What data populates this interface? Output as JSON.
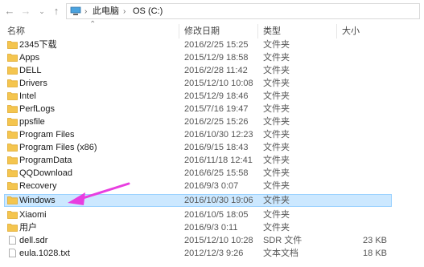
{
  "nav": {
    "back_icon": "arrow-left-icon",
    "forward_icon": "arrow-right-icon",
    "history_icon": "chevron-down-icon",
    "up_icon": "arrow-up-icon"
  },
  "address": {
    "root_separator": "›",
    "segments": [
      "此电脑",
      "OS (C:)"
    ]
  },
  "columns": {
    "name": "名称",
    "date": "修改日期",
    "type": "类型",
    "size": "大小"
  },
  "rows": [
    {
      "name": "2345下载",
      "date": "2016/2/25 15:25",
      "type": "文件夹",
      "size": "",
      "kind": "folder"
    },
    {
      "name": "Apps",
      "date": "2015/12/9 18:58",
      "type": "文件夹",
      "size": "",
      "kind": "folder"
    },
    {
      "name": "DELL",
      "date": "2016/2/28 11:42",
      "type": "文件夹",
      "size": "",
      "kind": "folder"
    },
    {
      "name": "Drivers",
      "date": "2015/12/10 10:08",
      "type": "文件夹",
      "size": "",
      "kind": "folder"
    },
    {
      "name": "Intel",
      "date": "2015/12/9 18:46",
      "type": "文件夹",
      "size": "",
      "kind": "folder"
    },
    {
      "name": "PerfLogs",
      "date": "2015/7/16 19:47",
      "type": "文件夹",
      "size": "",
      "kind": "folder"
    },
    {
      "name": "ppsfile",
      "date": "2016/2/25 15:26",
      "type": "文件夹",
      "size": "",
      "kind": "folder"
    },
    {
      "name": "Program Files",
      "date": "2016/10/30 12:23",
      "type": "文件夹",
      "size": "",
      "kind": "folder"
    },
    {
      "name": "Program Files (x86)",
      "date": "2016/9/15 18:43",
      "type": "文件夹",
      "size": "",
      "kind": "folder"
    },
    {
      "name": "ProgramData",
      "date": "2016/11/18 12:41",
      "type": "文件夹",
      "size": "",
      "kind": "folder"
    },
    {
      "name": "QQDownload",
      "date": "2016/6/25 15:58",
      "type": "文件夹",
      "size": "",
      "kind": "folder"
    },
    {
      "name": "Recovery",
      "date": "2016/9/3 0:07",
      "type": "文件夹",
      "size": "",
      "kind": "folder"
    },
    {
      "name": "Windows",
      "date": "2016/10/30 19:06",
      "type": "文件夹",
      "size": "",
      "kind": "folder",
      "selected": true
    },
    {
      "name": "Xiaomi",
      "date": "2016/10/5 18:05",
      "type": "文件夹",
      "size": "",
      "kind": "folder"
    },
    {
      "name": "用户",
      "date": "2016/9/3 0:11",
      "type": "文件夹",
      "size": "",
      "kind": "folder"
    },
    {
      "name": "dell.sdr",
      "date": "2015/12/10 10:28",
      "type": "SDR 文件",
      "size": "23 KB",
      "kind": "file"
    },
    {
      "name": "eula.1028.txt",
      "date": "2012/12/3 9:26",
      "type": "文本文档",
      "size": "18 KB",
      "kind": "file"
    }
  ],
  "colors": {
    "folder": "#f4c54f",
    "folder_dark": "#e0a82a",
    "selection_fill": "#cce8ff",
    "selection_border": "#99d1ff",
    "pointer": "#e83ee0"
  },
  "annotation": {
    "icon": "arrow-pointer-icon"
  }
}
